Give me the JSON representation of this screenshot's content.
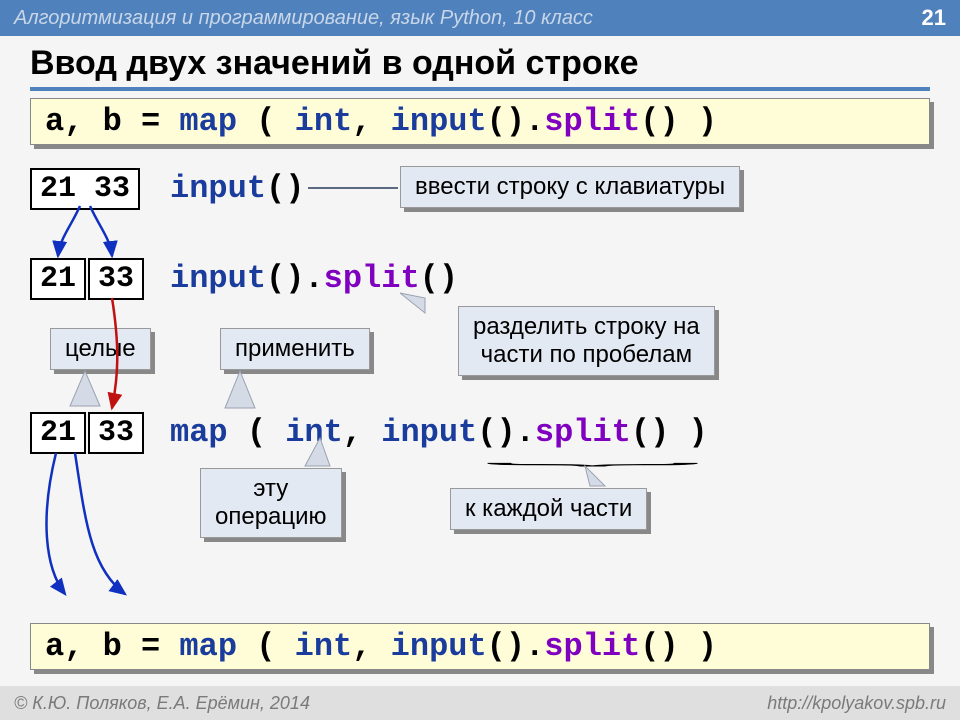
{
  "header": {
    "course": "Алгоритмизация и программирование, язык Python, 10 класс",
    "page": "21"
  },
  "title": "Ввод двух значений в одной строке",
  "codeTop": {
    "a": "a, b = ",
    "b": "map",
    "c": " ( ",
    "d": "int",
    "e": ", ",
    "f": "input",
    "g": "().",
    "h": "split",
    "i": "() )"
  },
  "step1": {
    "rawBox": "21 33",
    "code_a": "input",
    "code_b": "()",
    "call": "ввести строку с клавиатуры"
  },
  "step2": {
    "box1": "21",
    "box2": "33",
    "code_a": "input",
    "code_b": "().",
    "code_c": "split",
    "code_d": "()",
    "call_split": "разделить строку на\nчасти по пробелам"
  },
  "labels": {
    "whole": "целые",
    "apply": "применить",
    "this_op": "эту\nоперацию",
    "each_part": "к каждой части"
  },
  "step3": {
    "box1": "21",
    "box2": "33",
    "code_a": "map",
    "code_b": " ( ",
    "code_c": "int",
    "code_d": ", ",
    "code_e": "input",
    "code_f": "().",
    "code_g": "split",
    "code_h": "() )"
  },
  "codeBot": {
    "a": "a, b = ",
    "b": "map",
    "c": " ( ",
    "d": "int",
    "e": ", ",
    "f": "input",
    "g": "().",
    "h": "split",
    "i": "() )"
  },
  "footer": {
    "left": "© К.Ю. Поляков, Е.А. Ерёмин, 2014",
    "right": "http://kpolyakov.spb.ru"
  }
}
